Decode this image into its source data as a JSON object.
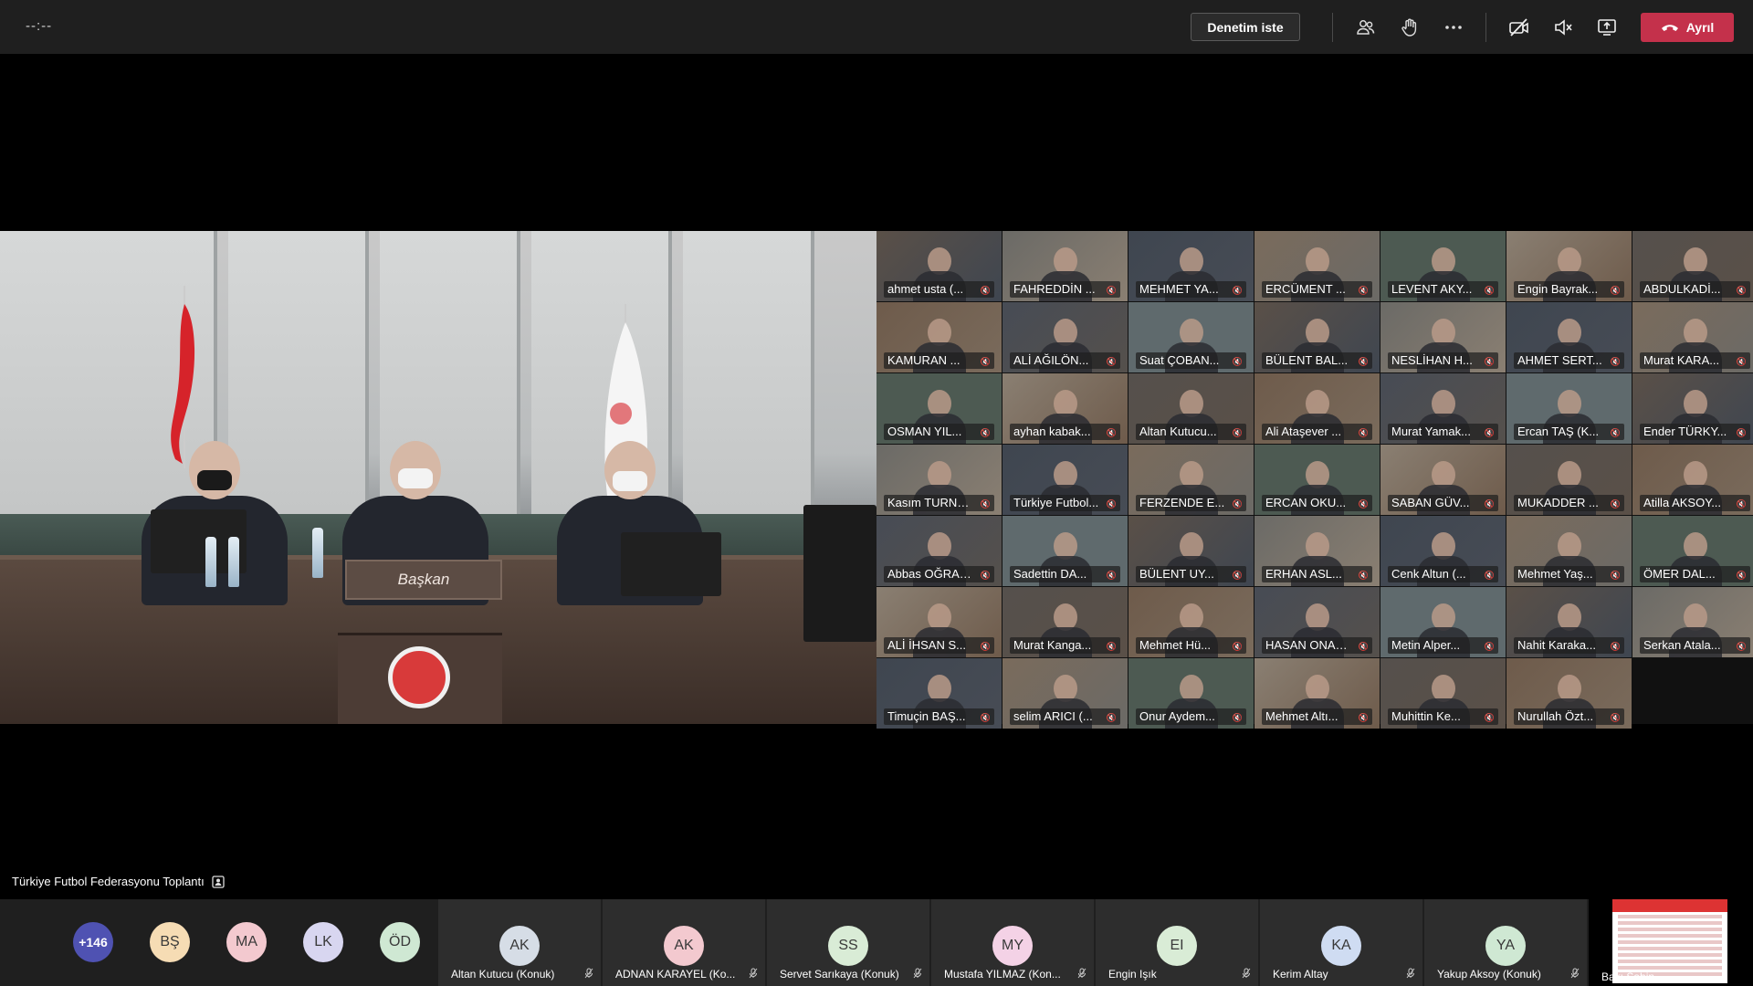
{
  "topbar": {
    "timer": "--:--",
    "control_button": "Denetim iste",
    "leave_button": "Ayrıl",
    "icons": [
      "participants-icon",
      "raise-hand-icon",
      "more-options-icon",
      "camera-off-icon",
      "speaker-mute-icon",
      "share-screen-icon",
      "phone-hangup-icon"
    ]
  },
  "room": {
    "nameplate": "Başkan"
  },
  "grid": {
    "tiles": [
      "ahmet usta (...",
      "FAHREDDİN ...",
      "MEHMET YA...",
      "ERCÜMENT ...",
      "LEVENT AKY...",
      "Engin Bayrak...",
      "ABDULKADİ...",
      "KAMURAN ...",
      "ALİ AĞILÖN...",
      "Suat ÇOBAN...",
      "BÜLENT BAL...",
      "NESLİHAN H...",
      "AHMET SERT...",
      "Murat KARA...",
      "OSMAN YIL...",
      "ayhan kabak...",
      "Altan Kutucu...",
      "Ali Ataşever ...",
      "Murat Yamak...",
      "Ercan TAŞ (K...",
      "Ender TÜRKY...",
      "Kasım TURNA...",
      "Türkiye Futbol...",
      "FERZENDE E...",
      "ERCAN OKU...",
      "SABAN GÜV...",
      "MUKADDER ...",
      "Atilla AKSOY...",
      "Abbas OĞRAŞ...",
      "Sadettin DA...",
      "BÜLENT UY...",
      "ERHAN ASL...",
      "Cenk Altun (...",
      "Mehmet Yaş...",
      "ÖMER DAL...",
      "ALİ İHSAN S...",
      "Murat Kanga...",
      "Mehmet Hü...",
      "HASAN ONAR...",
      "Metin Alper...",
      "Nahit Karaka...",
      "Serkan Atala...",
      "Timuçin BAŞ...",
      "selim ARICI (...",
      "Onur Aydem...",
      "Mehmet Altı...",
      "Muhittin Ke...",
      "Nurullah Özt..."
    ]
  },
  "meeting": {
    "title": "Türkiye Futbol Federasyonu Toplantı"
  },
  "roster": {
    "more_count": "+146",
    "small_avatars": [
      "BŞ",
      "MA",
      "LK",
      "ÖD"
    ],
    "participants": [
      {
        "initials": "AK",
        "name": "Altan Kutucu (Konuk)"
      },
      {
        "initials": "AK",
        "name": "ADNAN KARAYEL (Ko..."
      },
      {
        "initials": "SS",
        "name": "Servet Sarıkaya (Konuk)"
      },
      {
        "initials": "MY",
        "name": "Mustafa YILMAZ (Kon..."
      },
      {
        "initials": "EI",
        "name": "Engin Işık"
      },
      {
        "initials": "KA",
        "name": "Kerim Altay"
      },
      {
        "initials": "YA",
        "name": "Yakup Aksoy (Konuk)"
      }
    ],
    "shared_content_name": "Bakı Şahin"
  },
  "colors": {
    "topbar": "#1f1f1f",
    "leave": "#c4314b",
    "more_avatar": "#4f52b2"
  }
}
